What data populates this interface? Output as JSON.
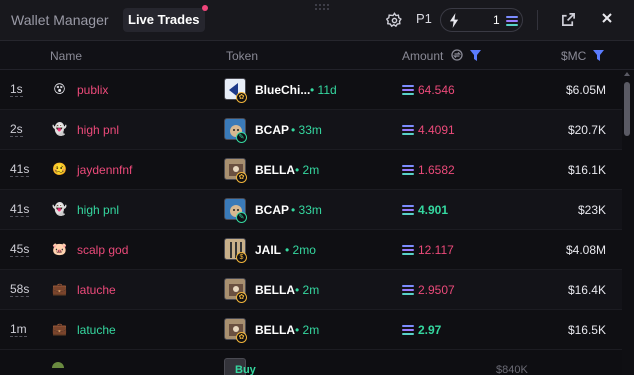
{
  "tabs": {
    "wallet_manager": "Wallet Manager",
    "live_trades": "Live Trades"
  },
  "toolbar": {
    "preset": "P1",
    "quick_buy_count": "1"
  },
  "columns": {
    "name": "Name",
    "token": "Token",
    "amount": "Amount",
    "mc": "$MC"
  },
  "colors": {
    "buy": "#35d8a0",
    "sell": "#ec4a7a",
    "background": "#0f0f13"
  },
  "trades": [
    {
      "age": "1s",
      "icon": "face-emoji",
      "wallet": "publix",
      "side": "sell",
      "token": "BlueChi...",
      "token_age": "11d",
      "amount": "64.546",
      "mc": "$6.05M"
    },
    {
      "age": "2s",
      "icon": "ghost-emoji",
      "wallet": "high pnl",
      "side": "sell",
      "token": "BCAP",
      "token_age": "33m",
      "amount": "4.4091",
      "mc": "$20.7K"
    },
    {
      "age": "41s",
      "icon": "face-emoji",
      "wallet": "jaydennfnf",
      "side": "sell",
      "token": "BELLA",
      "token_age": "2m",
      "amount": "1.6582",
      "mc": "$16.1K"
    },
    {
      "age": "41s",
      "icon": "ghost-emoji",
      "wallet": "high pnl",
      "side": "buy",
      "token": "BCAP",
      "token_age": "33m",
      "amount": "4.901",
      "mc": "$23K"
    },
    {
      "age": "45s",
      "icon": "pig-emoji",
      "wallet": "scalp god",
      "side": "sell",
      "token": "JAIL",
      "token_age": "2mo",
      "amount": "12.117",
      "mc": "$4.08M"
    },
    {
      "age": "58s",
      "icon": "briefcase-emoji",
      "wallet": "latuche",
      "side": "sell",
      "token": "BELLA",
      "token_age": "2m",
      "amount": "2.9507",
      "mc": "$16.4K"
    },
    {
      "age": "1m",
      "icon": "briefcase-emoji",
      "wallet": "latuche",
      "side": "buy",
      "token": "BELLA",
      "token_age": "2m",
      "amount": "2.97",
      "mc": "$16.5K"
    }
  ],
  "partial_row": {
    "buy_label": "Buy",
    "mc": "$840K"
  }
}
